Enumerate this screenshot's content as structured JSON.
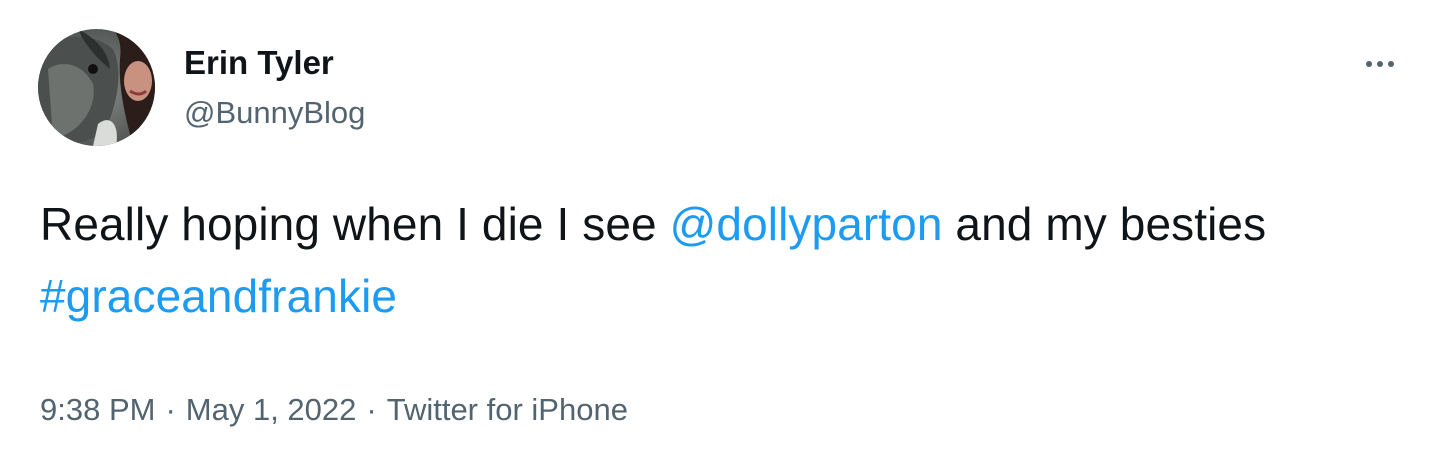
{
  "author": {
    "display_name": "Erin Tyler",
    "handle": "@BunnyBlog"
  },
  "tweet": {
    "text_part_1": "Really hoping when I die I see ",
    "mention": "@dollyparton",
    "text_part_2": " and my besties ",
    "hashtag": "#graceandfrankie"
  },
  "meta": {
    "time": "9:38 PM",
    "separator": "·",
    "date": "May 1, 2022",
    "source": "Twitter for iPhone"
  },
  "icons": {
    "more": "more-horizontal-icon"
  },
  "colors": {
    "link": "#1d9bf0",
    "secondary_text": "#536471",
    "primary_text": "#0f1419"
  }
}
